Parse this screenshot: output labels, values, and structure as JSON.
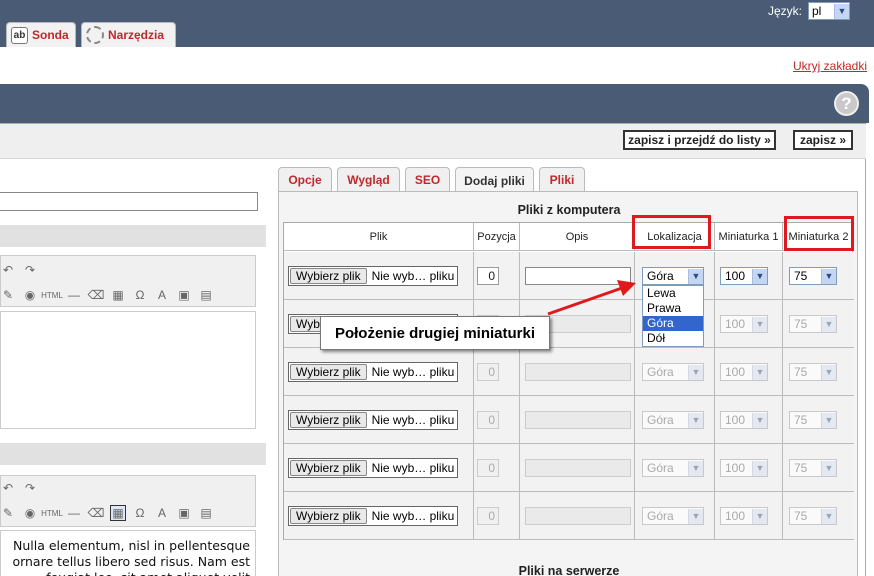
{
  "top": {
    "language_label": "Język:",
    "language_value": "pl",
    "tabs": [
      {
        "label": "Sonda",
        "icon": "poll-icon"
      },
      {
        "label": "Narzędzia",
        "icon": "gear-icon"
      }
    ],
    "hide_tabs_link": "Ukryj zakładki"
  },
  "toolbar": {
    "save_and_list": "zapisz i przejdź do listy »",
    "save": "zapisz »"
  },
  "editor": {
    "text": "Nulla elementum, nisl in pellentesque ornare tellus libero sed risus. Nam est feugiat leo, sit amet aliquet velit"
  },
  "panel": {
    "tabs": [
      {
        "label": "Opcje",
        "active": false
      },
      {
        "label": "Wygląd",
        "active": false
      },
      {
        "label": "SEO",
        "active": false
      },
      {
        "label": "Dodaj pliki",
        "active": true
      },
      {
        "label": "Pliki",
        "active": false
      }
    ],
    "local_title": "Pliki z komputera",
    "server_title": "Pliki na serwerze",
    "columns": [
      "Plik",
      "Pozycja",
      "Opis",
      "Lokalizacja",
      "Miniaturka 1",
      "Miniaturka 2"
    ],
    "file_button": "Wybierz plik",
    "rows": [
      {
        "file_text": "Nie wyb… pliku",
        "position": "0",
        "location": "Góra",
        "thumb1": "100",
        "thumb2": "75",
        "enabled": true
      },
      {
        "file_text": "Nie wyb… pliku",
        "position": "0",
        "location": "Góra",
        "thumb1": "100",
        "thumb2": "75",
        "enabled": false
      },
      {
        "file_text": "Nie wyb… pliku",
        "position": "0",
        "location": "Góra",
        "thumb1": "100",
        "thumb2": "75",
        "enabled": false
      },
      {
        "file_text": "Nie wyb… pliku",
        "position": "0",
        "location": "Góra",
        "thumb1": "100",
        "thumb2": "75",
        "enabled": false
      },
      {
        "file_text": "Nie wyb… pliku",
        "position": "0",
        "location": "Góra",
        "thumb1": "100",
        "thumb2": "75",
        "enabled": false
      },
      {
        "file_text": "Nie wyb… pliku",
        "position": "0",
        "location": "Góra",
        "thumb1": "100",
        "thumb2": "75",
        "enabled": false
      }
    ],
    "location_options": [
      "Lewa",
      "Prawa",
      "Góra",
      "Dół"
    ],
    "location_selected": "Góra"
  },
  "callout": {
    "text": "Położenie drugiej miniaturki"
  },
  "colors": {
    "header": "#4a5c75",
    "accent_red": "#c0282c",
    "highlight_box": "#e0191d",
    "selection": "#3366cc"
  }
}
